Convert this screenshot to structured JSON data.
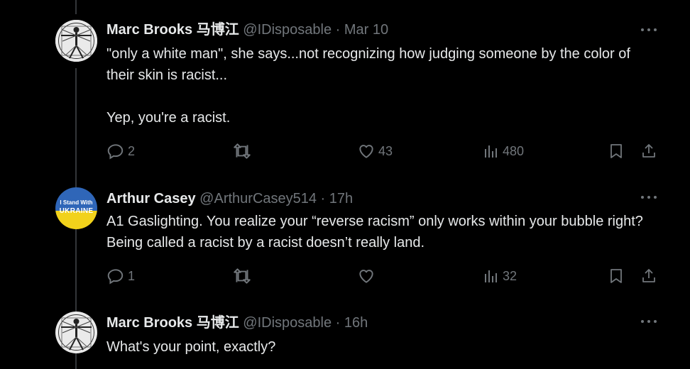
{
  "tweets": [
    {
      "name": "Marc Brooks 马博江",
      "handle": "@IDisposable",
      "time": "Mar 10",
      "text": "\"only a white man\", she says...not recognizing how judging someone by the color of their skin is racist...\n\nYep, you're a racist.",
      "replies": "2",
      "retweets": "",
      "likes": "43",
      "views": "480",
      "avatar": "vitruvian-avatar"
    },
    {
      "name": "Arthur Casey",
      "handle": "@ArthurCasey514",
      "time": "17h",
      "text": "A1 Gaslighting. You realize your “reverse racism” only works within your bubble right? Being called a racist by a racist doesn’t really land.",
      "replies": "1",
      "retweets": "",
      "likes": "",
      "views": "32",
      "avatar": "ukraine-avatar",
      "avatar_text_top": "I Stand With",
      "avatar_text_bottom": "UKRAINE"
    },
    {
      "name": "Marc Brooks 马博江",
      "handle": "@IDisposable",
      "time": "16h",
      "text": "What's your point, exactly?",
      "avatar": "vitruvian-avatar"
    }
  ],
  "separator": " · ",
  "colors": {
    "background": "#000000",
    "text": "#e7e9ea",
    "muted": "#71767b",
    "thread_line": "#333639",
    "ukraine_blue": "#2f66b8",
    "ukraine_yellow": "#f2d21b"
  }
}
